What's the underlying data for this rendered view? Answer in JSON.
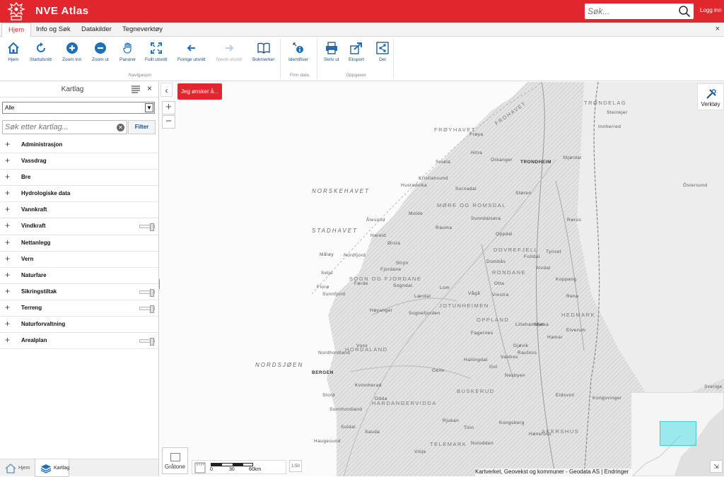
{
  "header": {
    "title": "NVE Atlas",
    "search_placeholder": "Søk...",
    "login": "Logg inn",
    "colors": {
      "brand": "#e1262d",
      "link": "#1c4f86"
    }
  },
  "tabs": [
    {
      "label": "Hjem",
      "active": true
    },
    {
      "label": "Info og Søk"
    },
    {
      "label": "Datakilder"
    },
    {
      "label": "Tegneverktøy"
    }
  ],
  "ribbon": {
    "close": "×",
    "groups": {
      "navigation": "Navigasjon",
      "find_data": "Finn data",
      "tasks": "Oppgaver"
    },
    "buttons": {
      "home": "Hjem",
      "start_extent": "Startutsnitt",
      "zoom_in": "Zoom inn",
      "zoom_out": "Zoom ut",
      "pan": "Panorer",
      "full_extent": "Fullt utsnitt",
      "previous_extent": "Forrige utsnitt",
      "next_extent": "Neste utsnitt",
      "bookmarks": "Bokmerker",
      "identify": "Identifiser",
      "print": "Skriv ut",
      "export": "Eksport",
      "share": "Del"
    }
  },
  "sidebar": {
    "title": "Kartlag",
    "close": "×",
    "filter_select": "Alle",
    "search_placeholder": "Søk etter kartlag...",
    "filter_button": "Filter",
    "layers": [
      {
        "name": "Administrasjon",
        "slider": false
      },
      {
        "name": "Vassdrag",
        "slider": false
      },
      {
        "name": "Bre",
        "slider": false
      },
      {
        "name": "Hydrologiske data",
        "slider": false
      },
      {
        "name": "Vannkraft",
        "slider": false
      },
      {
        "name": "Vindkraft",
        "slider": true
      },
      {
        "name": "Nettanlegg",
        "slider": false
      },
      {
        "name": "Vern",
        "slider": false
      },
      {
        "name": "Naturfare",
        "slider": false
      },
      {
        "name": "Sikringstiltak",
        "slider": true
      },
      {
        "name": "Terreng",
        "slider": true
      },
      {
        "name": "Naturforvaltning",
        "slider": false
      },
      {
        "name": "Arealplan",
        "slider": true
      }
    ],
    "bottom_tabs": [
      {
        "label": "Hjem",
        "active": false
      },
      {
        "label": "Kartlag",
        "active": true
      }
    ]
  },
  "map": {
    "action_button": "Jeg ønsker å...",
    "tools_button": "Verktøy",
    "basemap_button": "Gråtone",
    "scale_labels": [
      "0",
      "30",
      "60km"
    ],
    "scale_ratio": "1:50",
    "attribution": "Kartverket, Geovekst og kommuner - Geodata AS | Endringer",
    "labels": [
      {
        "text": "TRØNDELAG",
        "kind": "big"
      },
      {
        "text": "FRØYHAVET",
        "kind": "big"
      },
      {
        "text": "FROHAVET",
        "kind": "big"
      },
      {
        "text": "Frøya",
        "kind": ""
      },
      {
        "text": "Hitra",
        "kind": ""
      },
      {
        "text": "TRONDHEIM",
        "kind": "city"
      },
      {
        "text": "Orkanger",
        "kind": ""
      },
      {
        "text": "Smøla",
        "kind": ""
      },
      {
        "text": "Kristiansund",
        "kind": ""
      },
      {
        "text": "NORSKEHAVET",
        "kind": "sea"
      },
      {
        "text": "MØRE OG ROMSDAL",
        "kind": "big"
      },
      {
        "text": "Molde",
        "kind": ""
      },
      {
        "text": "Ålesund",
        "kind": ""
      },
      {
        "text": "STADHAVET",
        "kind": "sea"
      },
      {
        "text": "Sunndalsøra",
        "kind": ""
      },
      {
        "text": "Oppdal",
        "kind": ""
      },
      {
        "text": "Støren",
        "kind": ""
      },
      {
        "text": "Røros",
        "kind": ""
      },
      {
        "text": "DOVREFJELL",
        "kind": "big"
      },
      {
        "text": "RONDANE",
        "kind": "big"
      },
      {
        "text": "Dombås",
        "kind": ""
      },
      {
        "text": "Otta",
        "kind": ""
      },
      {
        "text": "Tynset",
        "kind": ""
      },
      {
        "text": "Stryn",
        "kind": ""
      },
      {
        "text": "Sogndal",
        "kind": ""
      },
      {
        "text": "SOGN OG FJORDANE",
        "kind": "big"
      },
      {
        "text": "JOTUNHEIMEN",
        "kind": "big"
      },
      {
        "text": "Førde",
        "kind": ""
      },
      {
        "text": "Florø",
        "kind": ""
      },
      {
        "text": "OPPLAND",
        "kind": "big"
      },
      {
        "text": "HEDMARK",
        "kind": "big"
      },
      {
        "text": "Lillehammer",
        "kind": ""
      },
      {
        "text": "Elverum",
        "kind": ""
      },
      {
        "text": "Hamar",
        "kind": ""
      },
      {
        "text": "Gjøvik",
        "kind": ""
      },
      {
        "text": "Hønefoss",
        "kind": ""
      },
      {
        "text": "Fagernes",
        "kind": ""
      },
      {
        "text": "HORDALAND",
        "kind": "big"
      },
      {
        "text": "BERGEN",
        "kind": "city"
      },
      {
        "text": "NORDSJØEN",
        "kind": "sea"
      },
      {
        "text": "Voss",
        "kind": ""
      },
      {
        "text": "Geilo",
        "kind": ""
      },
      {
        "text": "HARDANGERVIDDA",
        "kind": "big"
      },
      {
        "text": "BUSKERUD",
        "kind": "big"
      },
      {
        "text": "TELEMARK",
        "kind": "big"
      },
      {
        "text": "Odda",
        "kind": ""
      },
      {
        "text": "Rjukan",
        "kind": ""
      },
      {
        "text": "Kongsberg",
        "kind": ""
      },
      {
        "text": "Haugesund",
        "kind": ""
      },
      {
        "text": "AKERSHUS",
        "kind": "big"
      },
      {
        "text": "Sverige",
        "kind": ""
      },
      {
        "text": "Östersund",
        "kind": ""
      },
      {
        "text": "Innherred",
        "kind": ""
      },
      {
        "text": "Stjørdal",
        "kind": ""
      },
      {
        "text": "Steinkjer",
        "kind": ""
      },
      {
        "text": "Hustadvika",
        "kind": ""
      },
      {
        "text": "Rauma",
        "kind": ""
      },
      {
        "text": "Surnadal",
        "kind": ""
      },
      {
        "text": "Hareid",
        "kind": ""
      },
      {
        "text": "Ørsta",
        "kind": ""
      },
      {
        "text": "Måløy",
        "kind": ""
      },
      {
        "text": "Sunnfjord",
        "kind": ""
      },
      {
        "text": "Høyanger",
        "kind": ""
      },
      {
        "text": "Lærdal",
        "kind": ""
      },
      {
        "text": "Fjordane",
        "kind": ""
      },
      {
        "text": "Nordfjord",
        "kind": ""
      },
      {
        "text": "Selje",
        "kind": ""
      },
      {
        "text": "Sognefjorden",
        "kind": ""
      },
      {
        "text": "Nordhordland",
        "kind": ""
      },
      {
        "text": "Stord",
        "kind": ""
      },
      {
        "text": "Sunnhordland",
        "kind": ""
      },
      {
        "text": "Kvinnherad",
        "kind": ""
      },
      {
        "text": "Valdres",
        "kind": ""
      },
      {
        "text": "Hallingdal",
        "kind": ""
      },
      {
        "text": "Gol",
        "kind": ""
      },
      {
        "text": "Nesbyen",
        "kind": ""
      },
      {
        "text": "Rena",
        "kind": ""
      },
      {
        "text": "Koppang",
        "kind": ""
      },
      {
        "text": "Alvdal",
        "kind": ""
      },
      {
        "text": "Folldal",
        "kind": ""
      },
      {
        "text": "Vinstra",
        "kind": ""
      },
      {
        "text": "Lom",
        "kind": ""
      },
      {
        "text": "Vågå",
        "kind": ""
      },
      {
        "text": "Raufoss",
        "kind": ""
      },
      {
        "text": "Kongsvinger",
        "kind": ""
      },
      {
        "text": "Eidsvoll",
        "kind": ""
      },
      {
        "text": "Mjøsa",
        "kind": ""
      },
      {
        "text": "Notodden",
        "kind": ""
      },
      {
        "text": "Tinn",
        "kind": ""
      },
      {
        "text": "Vinje",
        "kind": ""
      },
      {
        "text": "Suldal",
        "kind": ""
      },
      {
        "text": "Sauda",
        "kind": ""
      }
    ]
  }
}
